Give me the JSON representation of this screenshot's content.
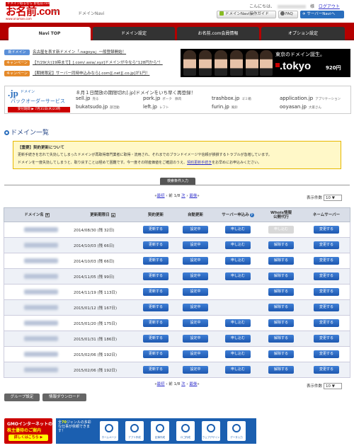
{
  "header": {
    "logo_tag": "ドメイン取るなら お名前.com",
    "logo_main": "お名前.com",
    "logo_sub": "NAVI",
    "logo_url": "www.onamae.com",
    "brand": "ドメインNavi",
    "greeting": "こんにちは、",
    "greeting_suffix": "様",
    "logout": "ログアウト",
    "guide_button": "ドメインNavi操作ガイド",
    "faq_button": "FAQ",
    "navi_button": "サーバーNaviへ"
  },
  "tabs": [
    "Navi TOP",
    "ドメイン設定",
    "お名前.com会員情報",
    "オプション設定"
  ],
  "news": [
    {
      "tag": "新ドメイン",
      "text": "名古屋を表す新ドメイン「.nagoya」一般登録開始！",
      "color": "#5a8fd8"
    },
    {
      "tag": "キャンペーン",
      "text": "【7/29(火)19時まで】[.com/.asia/.xyz]ドメインが今なら\"128円から\"！",
      "color": "#e58a2a"
    },
    {
      "tag": "キャンペーン",
      "text": "【期間限定】サーバー同時申込みなら[.com][.net][.co.jp]が1円！",
      "color": "#e58a2a"
    }
  ],
  "tokyo_banner": {
    "copy": "東京のドメイン誕生。",
    "domain": ".tokyo",
    "price": "920円"
  },
  "jp_banner": {
    "logo_big": ".jp",
    "logo_small": "ドメイン",
    "service": "バックオーダーサービス",
    "period": "受付期間 ▶ 7月31日(木)23時",
    "headline": "８月１日開放の期限切れ[.jp]ドメインをいち早く再登録！",
    "domains": [
      {
        "name": "sell.jp",
        "note": "売る"
      },
      {
        "name": "pork.jp",
        "note": "ポーク　豚肉"
      },
      {
        "name": "trashbox.jp",
        "note": "ゴミ箱"
      },
      {
        "name": "application.jp",
        "note": "アプリケーション"
      },
      {
        "name": "bukatsudo.jp",
        "note": "部活動"
      },
      {
        "name": "left.jp",
        "note": "レフト"
      },
      {
        "name": "furin.jp",
        "note": "風鈴"
      },
      {
        "name": "ooyasan.jp",
        "note": "大家さん"
      }
    ]
  },
  "section_title": "ドメイン一覧",
  "notice": {
    "title": "【重要】契約更新について",
    "line1": "更新手続きを忘れて失効してしまったドメインが再取得専門業者に取得・流用され、それまでのブランドイメージや信頼が損損するトラブルが急増しています。",
    "line2_before": "ドメインを一度失効してしまうと、取り戻すことは極めて困難です。今一度その財産価値をご確認のうえ、",
    "line2_link": "契約更新手続き",
    "line2_after": "をお早めにお申込みください。"
  },
  "filter_tab": "検索条件入力",
  "pager": {
    "first": "最初",
    "prev": "前",
    "page_info": "1/8",
    "next": "次",
    "last": "最後"
  },
  "per_page": {
    "label": "表示件数",
    "value": "10 ▼"
  },
  "table": {
    "headers": [
      "ドメイン名",
      "更新期限日",
      "契約更新",
      "自動更新",
      "サーバー申込み",
      "Whois情報\n公開代行",
      "ネームサーバー"
    ],
    "renew_label": "更新する",
    "auto_label": "設定中",
    "server_label": "申し込む",
    "whois_label": "解除する",
    "whois_disabled_label": "申し込む",
    "ns_label": "変更する",
    "rows": [
      {
        "expiry": "2014/08/30 (残 32日)",
        "server": true,
        "whois_disabled": true
      },
      {
        "expiry": "2014/10/03 (残 66日)",
        "server": true,
        "whois_disabled": false
      },
      {
        "expiry": "2014/10/03 (残 66日)",
        "server": true,
        "whois_disabled": false
      },
      {
        "expiry": "2014/11/05 (残 99日)",
        "server": true,
        "whois_disabled": false
      },
      {
        "expiry": "2014/11/19 (残 113日)",
        "server": false,
        "whois_disabled": false
      },
      {
        "expiry": "2015/01/12 (残 167日)",
        "server": false,
        "whois_disabled": false
      },
      {
        "expiry": "2015/01/20 (残 175日)",
        "server": true,
        "whois_disabled": false
      },
      {
        "expiry": "2015/01/31 (残 186日)",
        "server": true,
        "whois_disabled": false
      },
      {
        "expiry": "2015/02/06 (残 192日)",
        "server": true,
        "whois_disabled": false
      },
      {
        "expiry": "2015/02/06 (残 192日)",
        "server": true,
        "whois_disabled": false
      }
    ]
  },
  "bottom_buttons": {
    "group": "グループ設定",
    "download": "情報ダウンロード"
  },
  "gmo_banner": {
    "line1": "GMOインターネットの",
    "line2": "株主優待のご案内",
    "button": "詳しくはこちら ▶"
  },
  "job_banner": {
    "text_before": "全",
    "text_highlight": "70",
    "text_after": "ジャンルの多彩な仕事が依頼できます！",
    "icons": [
      "ホームページ",
      "アプリ作成",
      "記事作成",
      "ロゴ作成",
      "ウェブデザイン",
      "データ入力"
    ]
  }
}
